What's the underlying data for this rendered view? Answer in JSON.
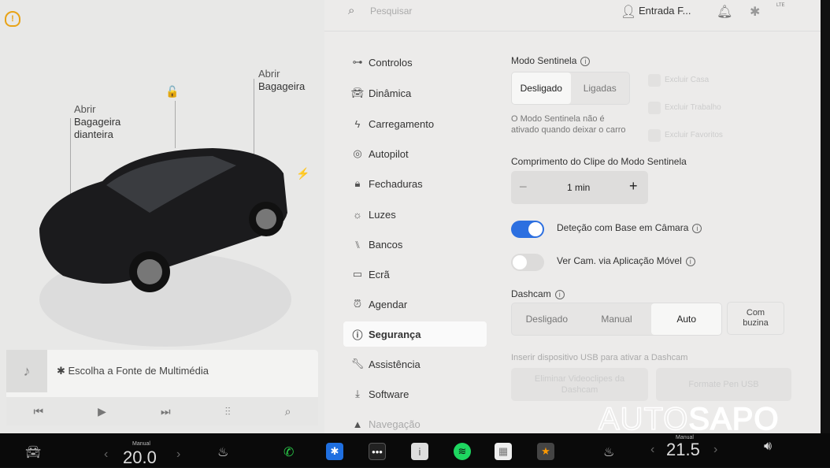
{
  "left": {
    "open_frunk": [
      "Abrir",
      "Bagageira",
      "dianteira"
    ],
    "open_trunk": [
      "Abrir",
      "Bagageira"
    ],
    "media_source": "Escolha a Fonte de Multimédia"
  },
  "topbar": {
    "search_placeholder": "Pesquisar",
    "profile": "Entrada F...",
    "signal": "LTE"
  },
  "menu": [
    {
      "label": "Controlos",
      "icon": "toggle-icon"
    },
    {
      "label": "Dinâmica",
      "icon": "car-icon"
    },
    {
      "label": "Carregamento",
      "icon": "bolt-icon"
    },
    {
      "label": "Autopilot",
      "icon": "steering-wheel-icon"
    },
    {
      "label": "Fechaduras",
      "icon": "lock-icon"
    },
    {
      "label": "Luzes",
      "icon": "sun-icon"
    },
    {
      "label": "Bancos",
      "icon": "seat-icon"
    },
    {
      "label": "Ecrã",
      "icon": "display-icon"
    },
    {
      "label": "Agendar",
      "icon": "alarm-icon"
    },
    {
      "label": "Segurança",
      "icon": "alert-circle-icon",
      "selected": true
    },
    {
      "label": "Assistência",
      "icon": "wrench-icon"
    },
    {
      "label": "Software",
      "icon": "download-icon"
    },
    {
      "label": "Navegação",
      "icon": "navigation-icon"
    }
  ],
  "sentry": {
    "title": "Modo Sentinela",
    "options": [
      "Desligado",
      "Ligadas"
    ],
    "selected": "Desligado",
    "note": "O Modo Sentinela não é ativado quando deixar o carro",
    "exclude": [
      "Excluir Casa",
      "Excluir Trabalho",
      "Excluir Favoritos"
    ],
    "clip_title": "Comprimento do Clipe do Modo Sentinela",
    "clip_value": "1 min",
    "camera_detection": {
      "label": "Deteção com Base em Câmara",
      "on": true
    },
    "mobile_view": {
      "label": "Ver Cam. via Aplicação Móvel",
      "on": false
    }
  },
  "dashcam": {
    "title": "Dashcam",
    "options": [
      "Desligado",
      "Manual",
      "Auto"
    ],
    "selected": "Auto",
    "honk": [
      "Com",
      "buzina"
    ],
    "usb_note": "Inserir dispositivo USB para ativar a Dashcam",
    "delete_label": "Eliminar Videoclipes da Dashcam",
    "format_label": "Formate Pen USB"
  },
  "taskbar": {
    "left_mode": "Manual",
    "left_temp": "20.0",
    "right_mode": "Manual",
    "right_temp": "21.5"
  },
  "watermark": "AUTOSAPO",
  "colors": {
    "accent": "#2c6fe0",
    "warning": "#e8a317"
  }
}
